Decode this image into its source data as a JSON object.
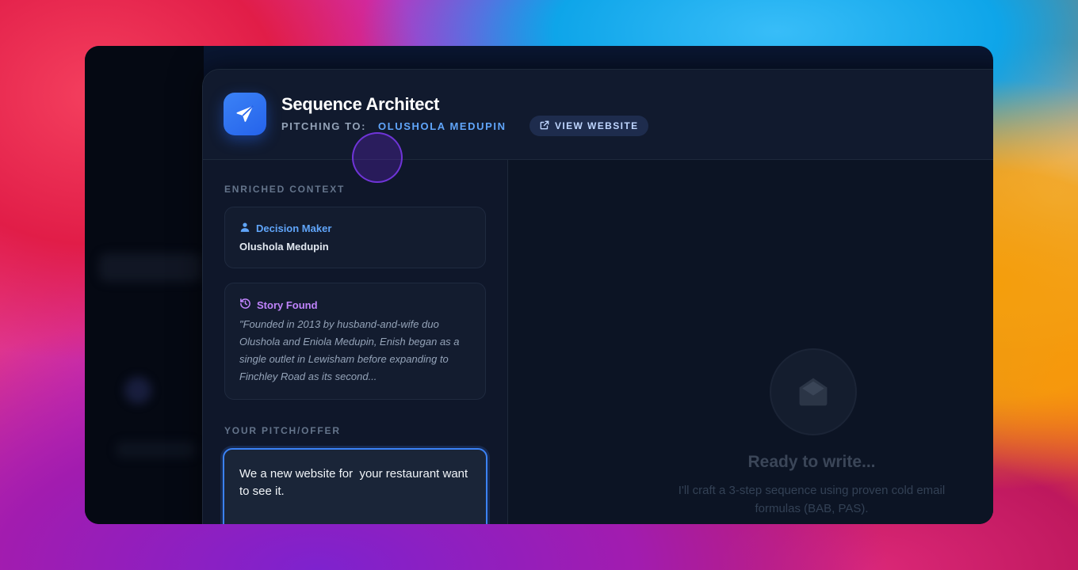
{
  "header": {
    "title": "Sequence Architect",
    "pitching_label": "PITCHING TO:",
    "pitching_name": "OLUSHOLA MEDUPIN",
    "view_website_label": "VIEW WEBSITE"
  },
  "context": {
    "section_label": "ENRICHED CONTEXT",
    "decision_maker": {
      "label": "Decision Maker",
      "value": "Olushola Medupin",
      "icon": "user-icon",
      "color": "#60a5fa"
    },
    "story": {
      "label": "Story Found",
      "text": "\"Founded in 2013 by husband-and-wife duo Olushola and Eniola Medupin, Enish began as a single outlet in Lewisham before expanding to Finchley Road as its second...",
      "icon": "history-icon",
      "color": "#c084fc"
    }
  },
  "pitch": {
    "section_label": "YOUR PITCH/OFFER",
    "value": "We a new website for  your restaurant want to see it."
  },
  "empty_state": {
    "icon": "envelope-open-icon",
    "title": "Ready to write...",
    "subtitle": "I'll craft a 3-step sequence using proven cold email formulas (BAB, PAS)."
  },
  "colors": {
    "accent": "#3b82f6",
    "link": "#60a5fa",
    "story": "#c084fc",
    "panel": "#0f172a"
  }
}
